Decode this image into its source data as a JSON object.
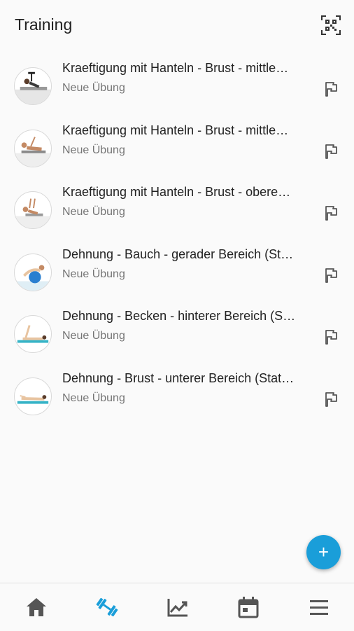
{
  "header": {
    "title": "Training",
    "qr_icon": "qr-code-icon"
  },
  "exercises": [
    {
      "title": "Kraeftigung mit Hanteln - Brust - mittle…",
      "subtitle": "Neue Übung"
    },
    {
      "title": "Kraeftigung mit Hanteln - Brust - mittle…",
      "subtitle": "Neue Übung"
    },
    {
      "title": "Kraeftigung mit Hanteln - Brust - obere…",
      "subtitle": "Neue Übung"
    },
    {
      "title": "Dehnung - Bauch - gerader Bereich (St…",
      "subtitle": "Neue Übung"
    },
    {
      "title": "Dehnung - Becken - hinterer Bereich (S…",
      "subtitle": "Neue Übung"
    },
    {
      "title": "Dehnung - Brust - unterer Bereich (Stat…",
      "subtitle": "Neue Übung"
    }
  ],
  "fab": {
    "label": "+",
    "color": "#1a9ed9"
  },
  "bottom_nav": [
    {
      "icon": "home-icon",
      "active": false
    },
    {
      "icon": "dumbbell-icon",
      "active": true
    },
    {
      "icon": "trending-chart-icon",
      "active": false
    },
    {
      "icon": "calendar-icon",
      "active": false
    },
    {
      "icon": "menu-icon",
      "active": false
    }
  ],
  "colors": {
    "accent": "#1a9ed9",
    "icon_inactive": "#555555"
  }
}
